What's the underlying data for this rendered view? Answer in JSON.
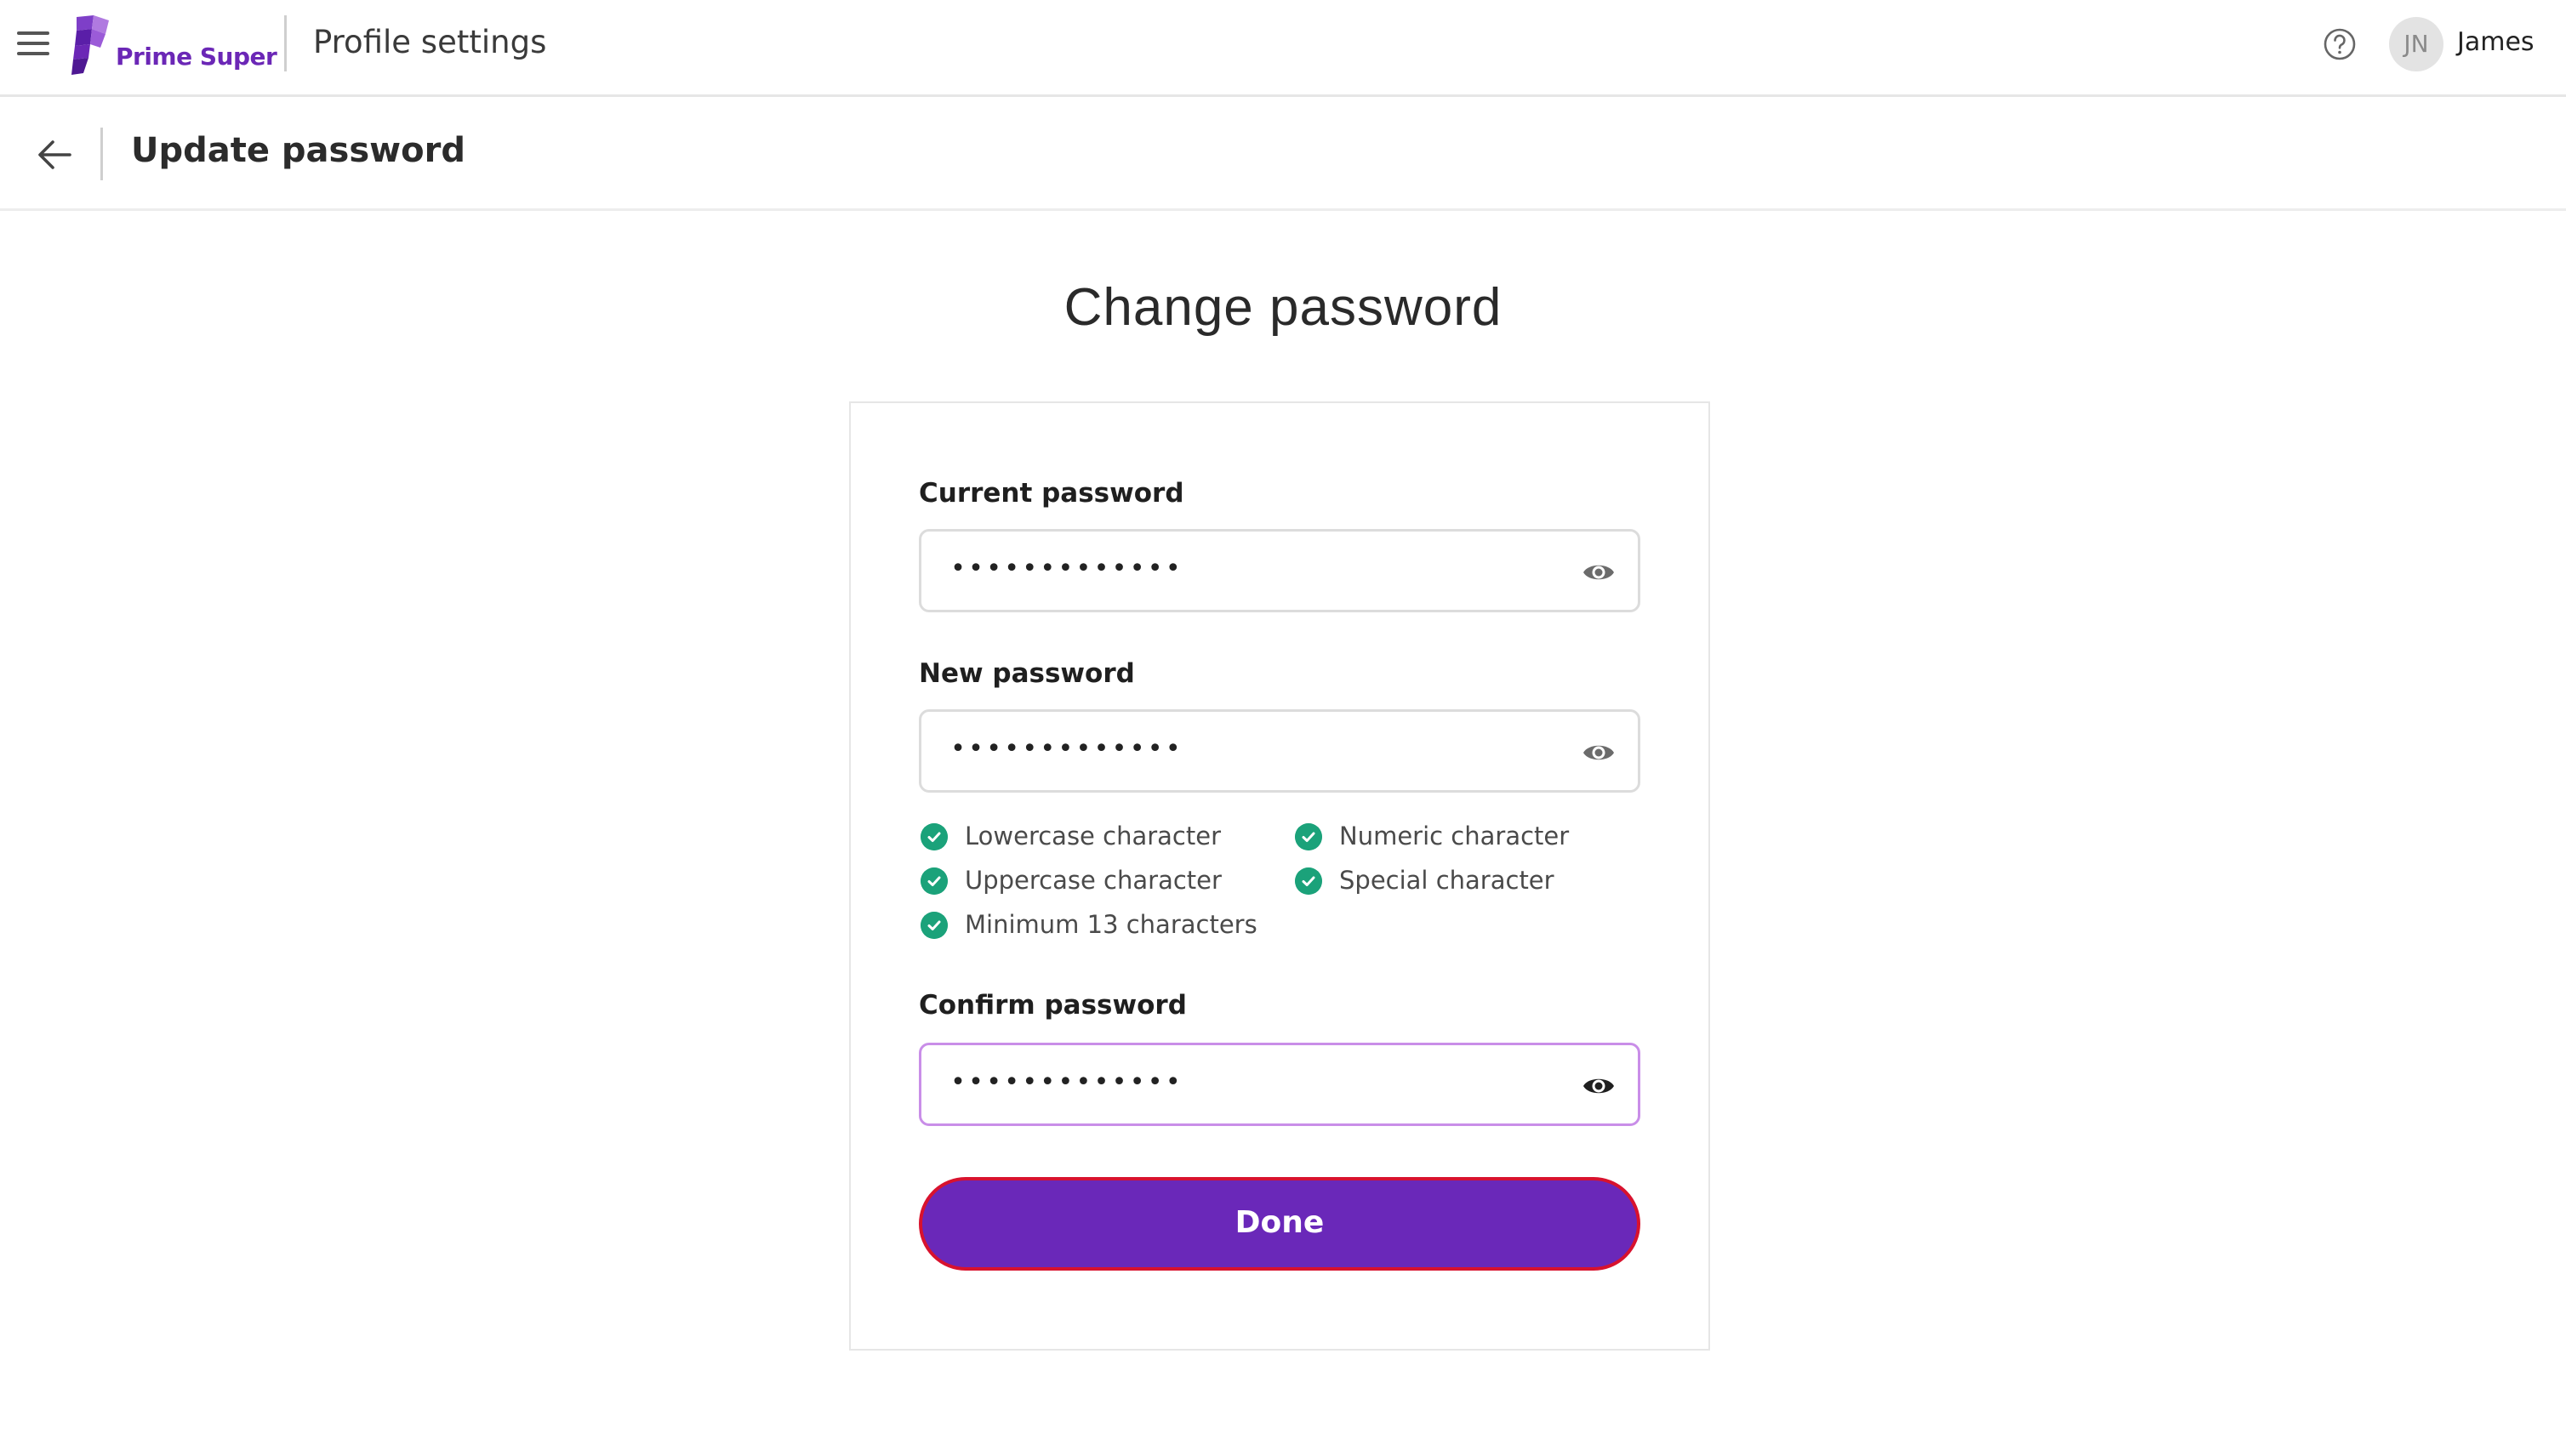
{
  "header": {
    "logo_text": "Prime Super",
    "app_title": "Profile settings",
    "user_initials": "JN",
    "user_name": "James"
  },
  "subheader": {
    "title": "Update password"
  },
  "main": {
    "heading": "Change password",
    "fields": {
      "current": {
        "label": "Current password",
        "value": "•••••••••••••"
      },
      "new": {
        "label": "New password",
        "value": "•••••••••••••"
      },
      "confirm": {
        "label": "Confirm password",
        "value": "•••••••••••••"
      }
    },
    "requirements": [
      {
        "label": "Lowercase character",
        "met": true
      },
      {
        "label": "Numeric character",
        "met": true
      },
      {
        "label": "Uppercase character",
        "met": true
      },
      {
        "label": "Special character",
        "met": true
      },
      {
        "label": "Minimum 13 characters",
        "met": true
      }
    ],
    "submit_label": "Done"
  },
  "colors": {
    "brand": "#6a28b9",
    "success": "#1ba27a",
    "focus_border": "#c98ee8",
    "button_outline": "#d8122e"
  },
  "icons": [
    "menu-icon",
    "logo-icon",
    "help-icon",
    "back-arrow-icon",
    "eye-icon",
    "check-icon"
  ]
}
